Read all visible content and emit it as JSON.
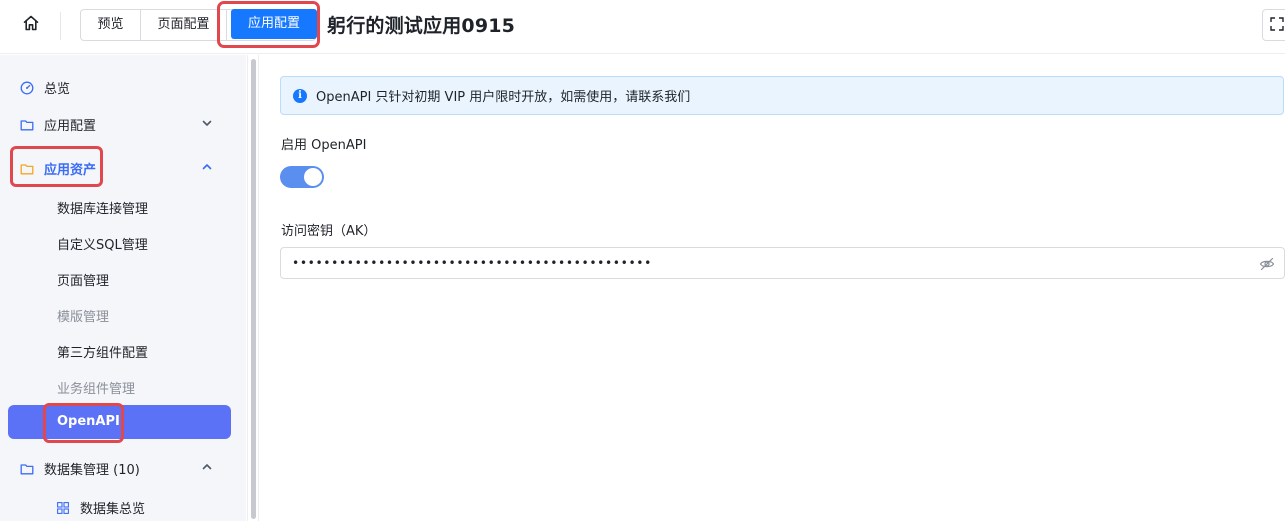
{
  "header": {
    "tabs": [
      {
        "label": "预览"
      },
      {
        "label": "页面配置"
      },
      {
        "label": "应用配置"
      }
    ],
    "app_title": "躬行的测试应用0915"
  },
  "sidebar": {
    "overview": "总览",
    "app_config": "应用配置",
    "app_assets": "应用资产",
    "asset_items": [
      {
        "label": "数据库连接管理"
      },
      {
        "label": "自定义SQL管理"
      },
      {
        "label": "页面管理"
      },
      {
        "label": "模版管理"
      },
      {
        "label": "第三方组件配置"
      },
      {
        "label": "业务组件管理"
      },
      {
        "label": "OpenAPI"
      }
    ],
    "dataset_mgmt": "数据集管理 (10)",
    "dataset_overview": "数据集总览"
  },
  "main": {
    "alert_text": "OpenAPI 只针对初期 VIP 用户限时开放，如需使用，请联系我们",
    "enable_label": "启用 OpenAPI",
    "enable_on": true,
    "ak_label": "访问密钥（AK）",
    "ak_value": "••••••••••••••••••••••••••••••••••••••••••••••"
  },
  "colors": {
    "primary": "#1677ff",
    "active_nav": "#5b71f6",
    "highlight": "#e0484e",
    "switch_on": "#5a8ff0"
  }
}
